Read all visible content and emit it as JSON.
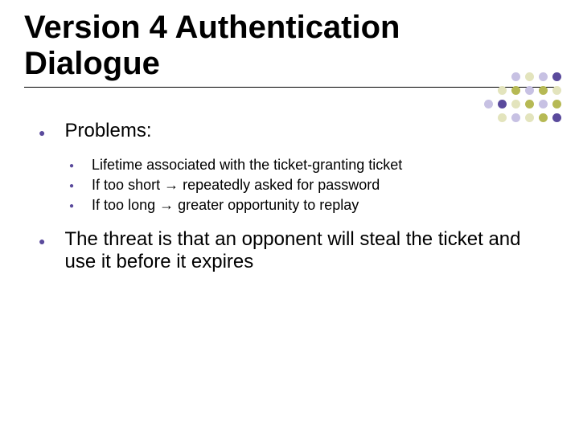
{
  "title": "Version 4 Authentication Dialogue",
  "bullets": {
    "b1": "Problems:",
    "sub": {
      "s1": "Lifetime associated with the ticket-granting ticket",
      "s2": "If too short → repeatedly asked for password",
      "s3": "If too long → greater opportunity to replay"
    },
    "b2": "The threat is that an opponent will steal the ticket and use it before it expires"
  }
}
